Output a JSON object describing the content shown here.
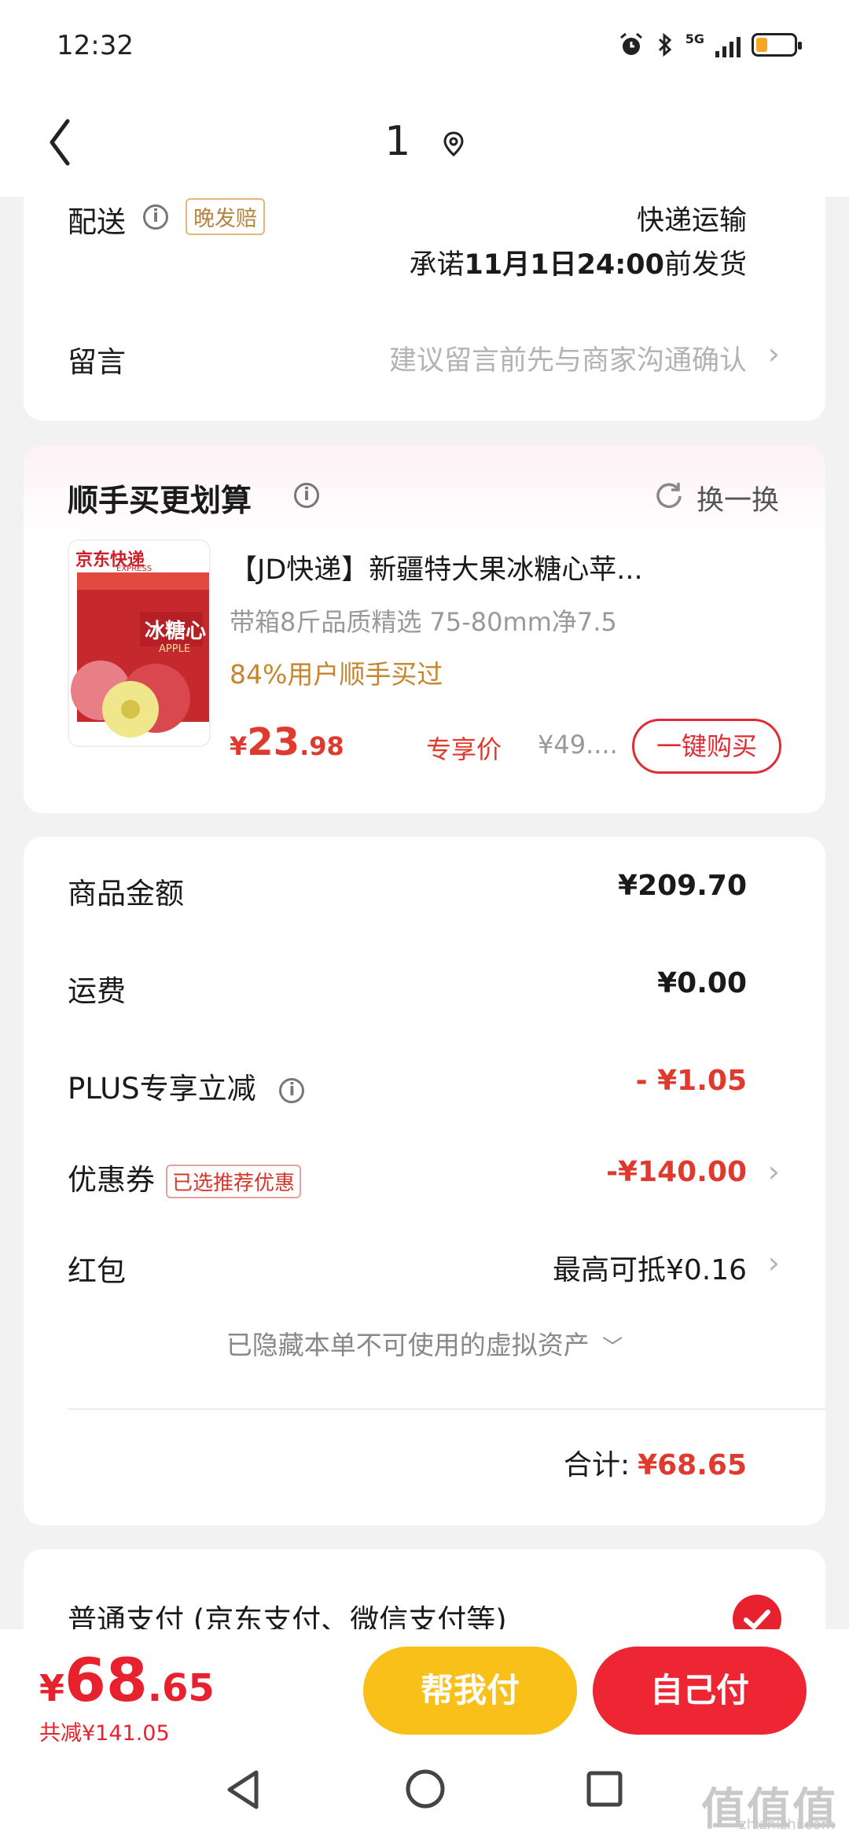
{
  "status_bar": {
    "time": "12:32",
    "network": "5G",
    "battery_level": 0.3
  },
  "nav": {
    "title": "1"
  },
  "delivery": {
    "label": "配送",
    "tag": "晚发赔",
    "method": "快递运输",
    "promise_prefix": "承诺",
    "promise_date": "11月1日24:00",
    "promise_suffix": "前发货"
  },
  "message": {
    "label": "留言",
    "placeholder": "建议留言前先与商家沟通确认"
  },
  "recommend": {
    "title": "顺手买更划算",
    "refresh": "换一换",
    "product_title": "【JD快递】新疆特大果冰糖心苹...",
    "product_desc": "带箱8斤品质精选 75-80mm净7.5",
    "social": "84%用户顺手买过",
    "price_symbol": "¥",
    "price_int": "23",
    "price_dec": ".98",
    "price_label": "专享价",
    "orig_price": "¥49....",
    "buy_button": "一键购买",
    "thumb_brand": "京东快递",
    "thumb_brand_sub": "EXPRESS",
    "thumb_name": "冰糖心",
    "thumb_name_sub": "APPLE"
  },
  "summary": {
    "goods_label": "商品金额",
    "goods_value": "¥209.70",
    "shipping_label": "运费",
    "shipping_value": "¥0.00",
    "plus_label": "PLUS专享立减",
    "plus_value": "- ¥1.05",
    "coupon_label": "优惠券",
    "coupon_tag": "已选推荐优惠",
    "coupon_value": "-¥140.00",
    "redpack_label": "红包",
    "redpack_value": "最高可抵¥0.16",
    "hidden_assets": "已隐藏本单不可使用的虚拟资产",
    "total_label": "合计:",
    "total_value": "¥68.65"
  },
  "payment": {
    "option": "普通支付 (京东支付、微信支付等)"
  },
  "bottom": {
    "price_symbol": "¥",
    "price_int": "68",
    "price_dec": ".65",
    "saved": "共减¥141.05",
    "help_pay": "帮我付",
    "self_pay": "自己付"
  },
  "watermark": {
    "text": "值值值",
    "sub": "zhizhizhi.com"
  },
  "colors": {
    "accent_red": "#e8212e",
    "accent_yellow": "#f9c019",
    "tag_orange": "#b7853f"
  }
}
